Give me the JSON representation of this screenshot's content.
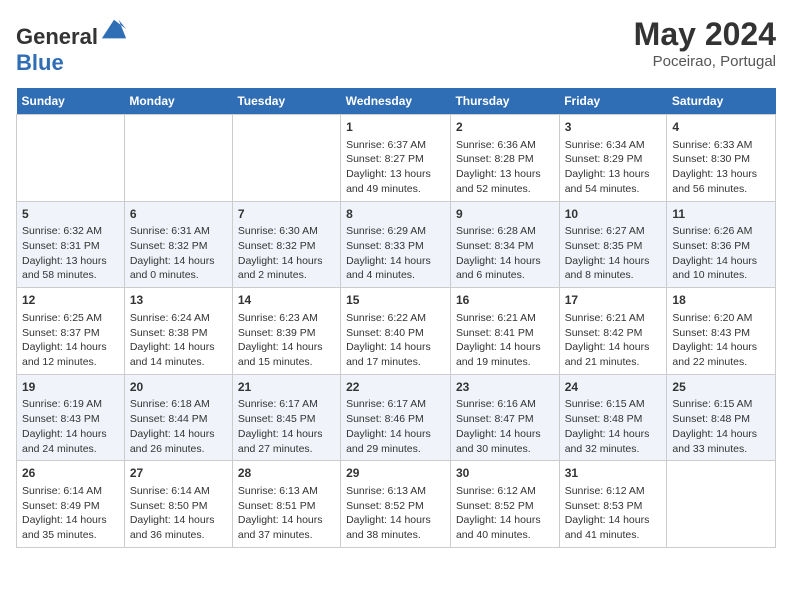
{
  "header": {
    "logo_general": "General",
    "logo_blue": "Blue",
    "month_title": "May 2024",
    "location": "Poceirao, Portugal"
  },
  "days_of_week": [
    "Sunday",
    "Monday",
    "Tuesday",
    "Wednesday",
    "Thursday",
    "Friday",
    "Saturday"
  ],
  "weeks": [
    [
      {
        "day": "",
        "content": ""
      },
      {
        "day": "",
        "content": ""
      },
      {
        "day": "",
        "content": ""
      },
      {
        "day": "1",
        "content": "Sunrise: 6:37 AM\nSunset: 8:27 PM\nDaylight: 13 hours and 49 minutes."
      },
      {
        "day": "2",
        "content": "Sunrise: 6:36 AM\nSunset: 8:28 PM\nDaylight: 13 hours and 52 minutes."
      },
      {
        "day": "3",
        "content": "Sunrise: 6:34 AM\nSunset: 8:29 PM\nDaylight: 13 hours and 54 minutes."
      },
      {
        "day": "4",
        "content": "Sunrise: 6:33 AM\nSunset: 8:30 PM\nDaylight: 13 hours and 56 minutes."
      }
    ],
    [
      {
        "day": "5",
        "content": "Sunrise: 6:32 AM\nSunset: 8:31 PM\nDaylight: 13 hours and 58 minutes."
      },
      {
        "day": "6",
        "content": "Sunrise: 6:31 AM\nSunset: 8:32 PM\nDaylight: 14 hours and 0 minutes."
      },
      {
        "day": "7",
        "content": "Sunrise: 6:30 AM\nSunset: 8:32 PM\nDaylight: 14 hours and 2 minutes."
      },
      {
        "day": "8",
        "content": "Sunrise: 6:29 AM\nSunset: 8:33 PM\nDaylight: 14 hours and 4 minutes."
      },
      {
        "day": "9",
        "content": "Sunrise: 6:28 AM\nSunset: 8:34 PM\nDaylight: 14 hours and 6 minutes."
      },
      {
        "day": "10",
        "content": "Sunrise: 6:27 AM\nSunset: 8:35 PM\nDaylight: 14 hours and 8 minutes."
      },
      {
        "day": "11",
        "content": "Sunrise: 6:26 AM\nSunset: 8:36 PM\nDaylight: 14 hours and 10 minutes."
      }
    ],
    [
      {
        "day": "12",
        "content": "Sunrise: 6:25 AM\nSunset: 8:37 PM\nDaylight: 14 hours and 12 minutes."
      },
      {
        "day": "13",
        "content": "Sunrise: 6:24 AM\nSunset: 8:38 PM\nDaylight: 14 hours and 14 minutes."
      },
      {
        "day": "14",
        "content": "Sunrise: 6:23 AM\nSunset: 8:39 PM\nDaylight: 14 hours and 15 minutes."
      },
      {
        "day": "15",
        "content": "Sunrise: 6:22 AM\nSunset: 8:40 PM\nDaylight: 14 hours and 17 minutes."
      },
      {
        "day": "16",
        "content": "Sunrise: 6:21 AM\nSunset: 8:41 PM\nDaylight: 14 hours and 19 minutes."
      },
      {
        "day": "17",
        "content": "Sunrise: 6:21 AM\nSunset: 8:42 PM\nDaylight: 14 hours and 21 minutes."
      },
      {
        "day": "18",
        "content": "Sunrise: 6:20 AM\nSunset: 8:43 PM\nDaylight: 14 hours and 22 minutes."
      }
    ],
    [
      {
        "day": "19",
        "content": "Sunrise: 6:19 AM\nSunset: 8:43 PM\nDaylight: 14 hours and 24 minutes."
      },
      {
        "day": "20",
        "content": "Sunrise: 6:18 AM\nSunset: 8:44 PM\nDaylight: 14 hours and 26 minutes."
      },
      {
        "day": "21",
        "content": "Sunrise: 6:17 AM\nSunset: 8:45 PM\nDaylight: 14 hours and 27 minutes."
      },
      {
        "day": "22",
        "content": "Sunrise: 6:17 AM\nSunset: 8:46 PM\nDaylight: 14 hours and 29 minutes."
      },
      {
        "day": "23",
        "content": "Sunrise: 6:16 AM\nSunset: 8:47 PM\nDaylight: 14 hours and 30 minutes."
      },
      {
        "day": "24",
        "content": "Sunrise: 6:15 AM\nSunset: 8:48 PM\nDaylight: 14 hours and 32 minutes."
      },
      {
        "day": "25",
        "content": "Sunrise: 6:15 AM\nSunset: 8:48 PM\nDaylight: 14 hours and 33 minutes."
      }
    ],
    [
      {
        "day": "26",
        "content": "Sunrise: 6:14 AM\nSunset: 8:49 PM\nDaylight: 14 hours and 35 minutes."
      },
      {
        "day": "27",
        "content": "Sunrise: 6:14 AM\nSunset: 8:50 PM\nDaylight: 14 hours and 36 minutes."
      },
      {
        "day": "28",
        "content": "Sunrise: 6:13 AM\nSunset: 8:51 PM\nDaylight: 14 hours and 37 minutes."
      },
      {
        "day": "29",
        "content": "Sunrise: 6:13 AM\nSunset: 8:52 PM\nDaylight: 14 hours and 38 minutes."
      },
      {
        "day": "30",
        "content": "Sunrise: 6:12 AM\nSunset: 8:52 PM\nDaylight: 14 hours and 40 minutes."
      },
      {
        "day": "31",
        "content": "Sunrise: 6:12 AM\nSunset: 8:53 PM\nDaylight: 14 hours and 41 minutes."
      },
      {
        "day": "",
        "content": ""
      }
    ]
  ]
}
